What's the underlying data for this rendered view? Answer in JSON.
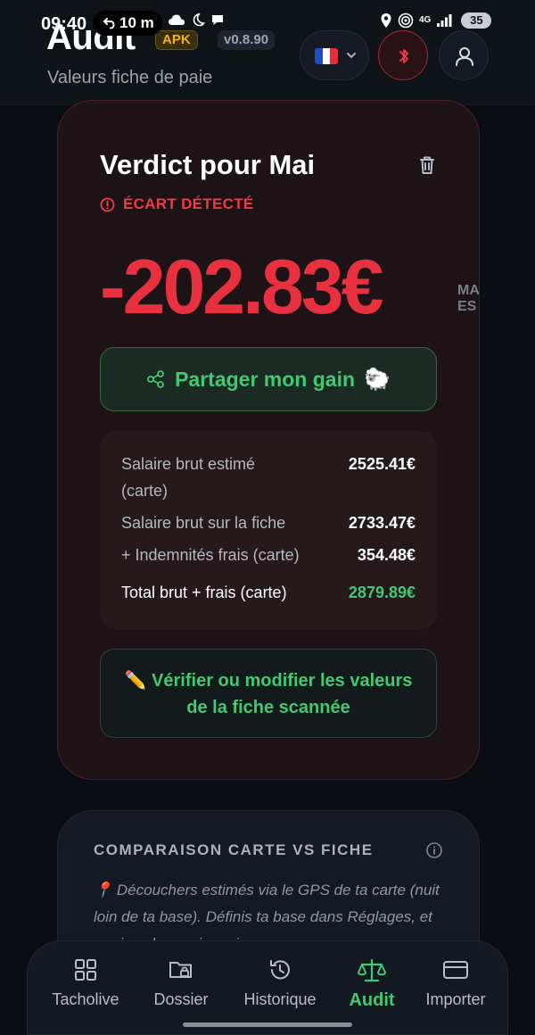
{
  "status_bar": {
    "time": "09:40",
    "timer": "10 m",
    "network": "4G",
    "battery": "35"
  },
  "header": {
    "title": "Audit",
    "apk_badge": "APK",
    "version": "v0.8.90",
    "subtitle": "Valeurs fiche de paie",
    "language_flag": "france-flag",
    "bluetooth_state_color": "#a32834"
  },
  "verdict": {
    "title": "Verdict pour Mai",
    "status": "ÉCART DÉTECTÉ",
    "amount": "-202.83€",
    "cut_label_line1": "MA",
    "cut_label_line2": "ES",
    "share_label": "Partager mon gain",
    "share_emoji": "🐑",
    "rows": [
      {
        "label": "Salaire brut estimé",
        "label2": "(carte)",
        "value": "2525.41€"
      },
      {
        "label": "Salaire brut sur la fiche",
        "value": "2733.47€"
      },
      {
        "label": "+ Indemnités frais (carte)",
        "value": "354.48€"
      },
      {
        "label": "Total brut + frais (carte)",
        "value": "2879.89€"
      }
    ],
    "verify_line1": "✏️ Vérifier ou modifier les valeurs",
    "verify_line2": "de la fiche scannée",
    "accent_red": "#e8313f",
    "accent_green": "#43c873"
  },
  "comparison": {
    "title": "COMPARAISON CARTE VS FICHE",
    "text": "📍 Découchers estimés via le GPS de ta carte (nuit loin de ta base). Définis ta base dans Réglages, et corrige chaque jour si"
  },
  "nav": {
    "items": [
      {
        "label": "Tacholive",
        "icon": "grid-icon"
      },
      {
        "label": "Dossier",
        "icon": "folder-lock-icon"
      },
      {
        "label": "Historique",
        "icon": "history-icon"
      },
      {
        "label": "Audit",
        "icon": "scale-icon"
      },
      {
        "label": "Importer",
        "icon": "card-icon"
      }
    ],
    "active": "Audit"
  }
}
